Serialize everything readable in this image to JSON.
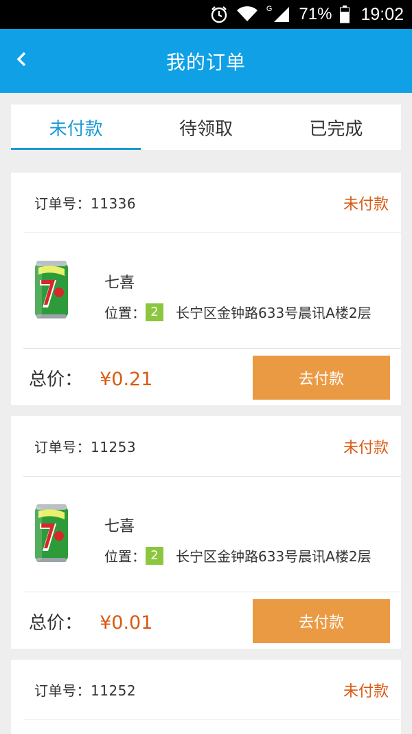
{
  "status_bar": {
    "battery": "71%",
    "time": "19:02",
    "network": "G",
    "icons": [
      "alarm-icon",
      "wifi-icon",
      "signal-icon",
      "battery-icon"
    ]
  },
  "app_bar": {
    "title": "我的订单",
    "back_icon": "chevron-left-icon"
  },
  "tabs": [
    {
      "label": "未付款",
      "active": true
    },
    {
      "label": "待领取",
      "active": false
    },
    {
      "label": "已完成",
      "active": false
    }
  ],
  "orders": [
    {
      "order_no_label": "订单号：11336",
      "status": "未付款",
      "product_name": "七喜",
      "location_label": "位置：",
      "location_badge": "2",
      "address": "长宁区金钟路633号晨讯A楼2层",
      "total_label": "总价：",
      "total_value": "¥0.21",
      "pay_label": "去付款"
    },
    {
      "order_no_label": "订单号：11253",
      "status": "未付款",
      "product_name": "七喜",
      "location_label": "位置：",
      "location_badge": "2",
      "address": "长宁区金钟路633号晨讯A楼2层",
      "total_label": "总价：",
      "total_value": "¥0.01",
      "pay_label": "去付款"
    },
    {
      "order_no_label": "订单号：11252",
      "status": "未付款"
    }
  ],
  "colors": {
    "app_bar": "#0fa0e6",
    "active_tab": "#1a9ad6",
    "status_text": "#d95a12",
    "pay_button": "#eb9a44",
    "location_badge": "#8cc63f"
  }
}
